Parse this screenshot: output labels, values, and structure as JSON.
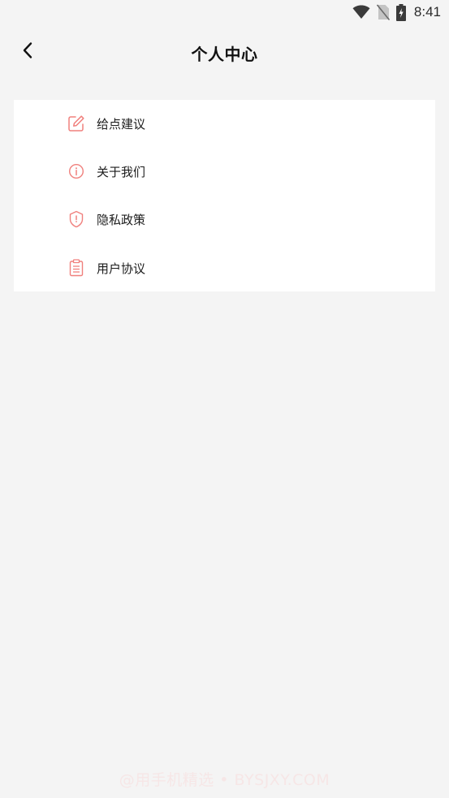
{
  "status_bar": {
    "time": "8:41",
    "icons": [
      "wifi-icon",
      "no-sim-icon",
      "battery-charging-icon"
    ]
  },
  "header": {
    "title": "个人中心",
    "back_icon": "chevron-left-icon"
  },
  "menu": {
    "accent_color": "#f0807d",
    "items": [
      {
        "label": "给点建议",
        "icon": "edit-icon"
      },
      {
        "label": "关于我们",
        "icon": "info-icon"
      },
      {
        "label": "隐私政策",
        "icon": "shield-icon"
      },
      {
        "label": "用户协议",
        "icon": "clipboard-icon"
      }
    ]
  },
  "watermark": {
    "text": "@用手机精选 • BYSJXY.COM"
  }
}
